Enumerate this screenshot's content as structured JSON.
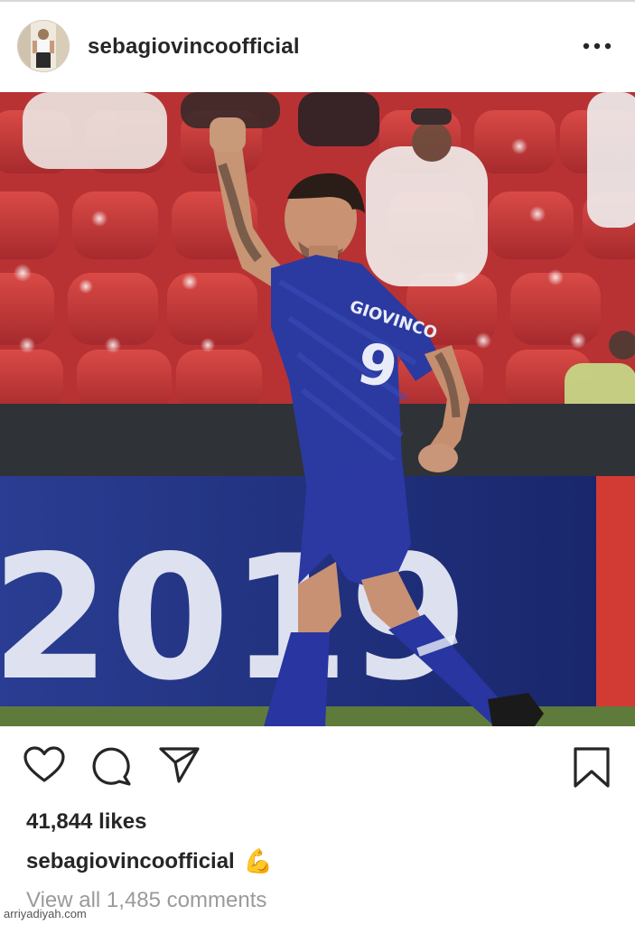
{
  "post": {
    "username": "sebagiovincoofficial",
    "photo_banner_text": "2019",
    "jersey_name": "GIOVINCO",
    "jersey_number": "9",
    "likes": "41,844 likes",
    "caption_user": "sebagiovincoofficial",
    "caption_emoji": "💪",
    "view_comments": "View all 1,485 comments"
  },
  "icons": {
    "more": "more-options-icon",
    "like": "heart-icon",
    "comment": "comment-icon",
    "share": "send-icon",
    "save": "bookmark-icon"
  },
  "watermark": "arriyadiyah.com",
  "colors": {
    "text": "#262626",
    "muted": "#9a9a9a",
    "jersey": "#2a3a9e",
    "seats": "#c8363a",
    "banner": "#22348a"
  }
}
